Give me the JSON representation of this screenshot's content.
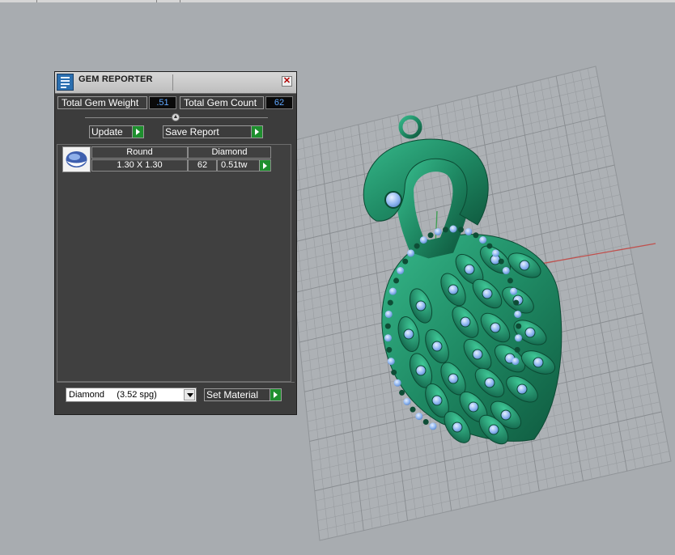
{
  "panel": {
    "title": "GEM REPORTER",
    "close_glyph": "✕",
    "total_weight_label": "Total Gem Weight",
    "total_weight_value": ".51",
    "total_count_label": "Total Gem Count",
    "total_count_value": "62",
    "update_label": "Update",
    "save_report_label": "Save Report",
    "gem_row": {
      "shape": "Round",
      "material": "Diamond",
      "size": "1.30 X 1.30",
      "count": "62",
      "weight": "0.51tw"
    },
    "material_select_value": "Diamond     (3.52 spg)",
    "set_material_label": "Set Material"
  },
  "colors": {
    "panel_bg": "#3c3c3c",
    "value_text": "#5fa8ff",
    "go_button": "#1e8f2e",
    "model_green": "#1f8a64",
    "gem_blue": "#a8c8f5",
    "viewport_bg": "#a8acb0"
  },
  "icons": [
    "gem-reporter-app-icon",
    "close-icon",
    "play-arrow-icon",
    "dropdown-arrow-icon",
    "collapse-grip-icon",
    "gem-thumbnail-icon"
  ]
}
